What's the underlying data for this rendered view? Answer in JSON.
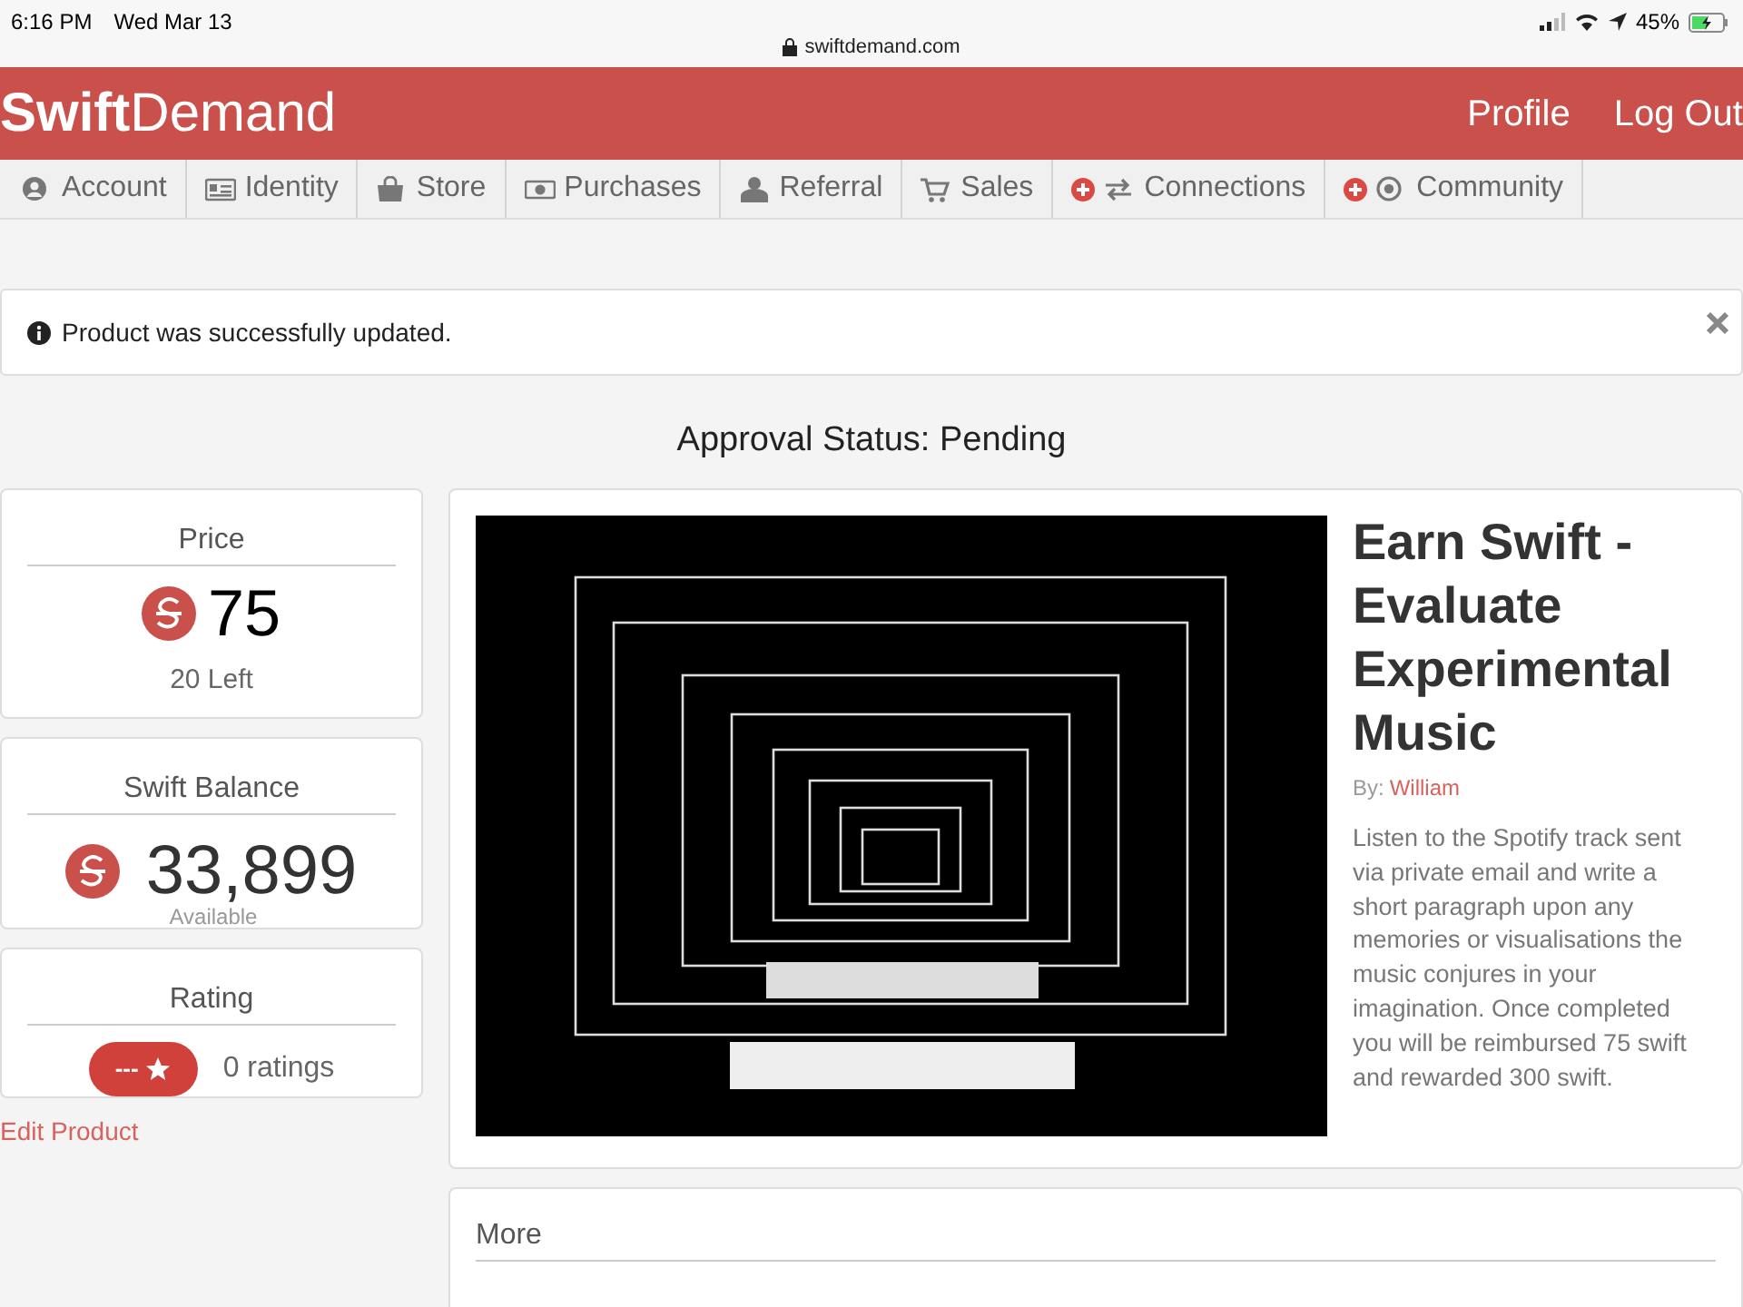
{
  "status_bar": {
    "time": "6:16 PM",
    "date": "Wed Mar 13",
    "url": "swiftdemand.com",
    "battery": "45%"
  },
  "header": {
    "logo": "**Swift**Demand",
    "links": [
      "Profile",
      "Log Out"
    ]
  },
  "nav": [
    {
      "label": "Account"
    },
    {
      "label": "Identity"
    },
    {
      "label": "Store"
    },
    {
      "label": "Purchases"
    },
    {
      "label": "Referral"
    },
    {
      "label": "Sales"
    },
    {
      "label": "Connections"
    },
    {
      "label": "Community"
    }
  ],
  "alert": {
    "message": "Product was successfully updated."
  },
  "approval_status": "Approval Status: Pending",
  "price": {
    "title": "Price",
    "value": "75",
    "left": "20 Left"
  },
  "balance": {
    "title": "Swift Balance",
    "value": "33,899",
    "caption": "Available"
  },
  "rating": {
    "title": "Rating",
    "badge": "---",
    "count": "0 ratings"
  },
  "edit_link": "Edit Product",
  "product": {
    "title": "Earn Swift - Evaluate Experimental Music",
    "by_label": "By:",
    "author": "William",
    "description": "Listen to the Spotify track sent via private email and write a short paragraph upon any memories or visualisations the music conjures in your imagination. Once completed you will be reimbursed 75 swift and rewarded 300 swift."
  },
  "more": {
    "title": "More"
  }
}
